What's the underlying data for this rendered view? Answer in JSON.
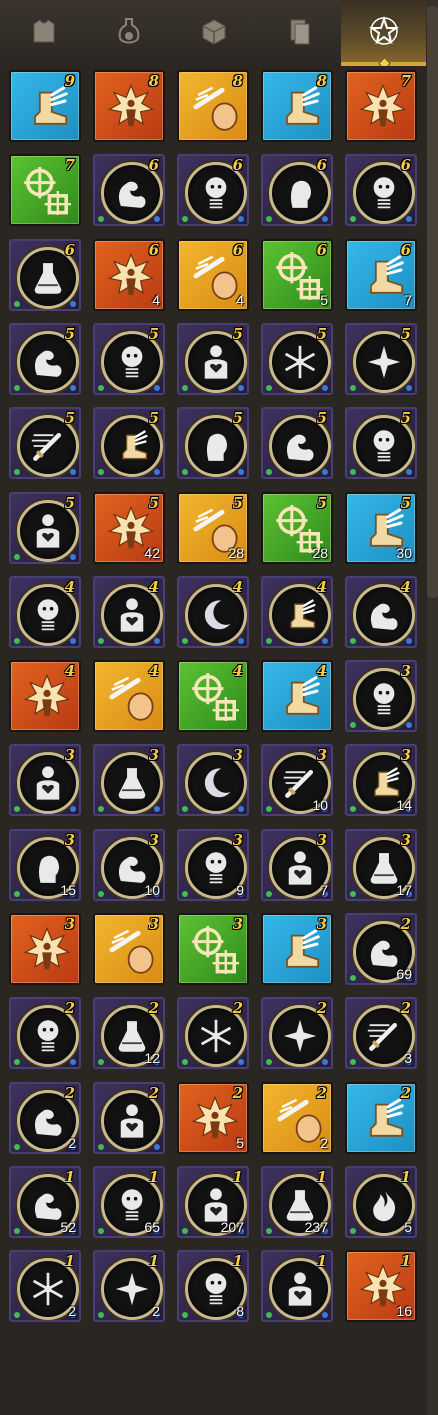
{
  "tabs": [
    {
      "name": "armor-tab",
      "icon": "armor-icon"
    },
    {
      "name": "potion-tab",
      "icon": "potion-icon"
    },
    {
      "name": "materials-tab",
      "icon": "cubes-icon"
    },
    {
      "name": "cards-tab",
      "icon": "cards-icon"
    },
    {
      "name": "runes-tab",
      "icon": "star-emblem-icon",
      "active": true
    }
  ],
  "tile_styles": {
    "blue": [
      "#1d8fc3",
      "#35b8e8"
    ],
    "red": [
      "#b93a14",
      "#e2631e"
    ],
    "orange": [
      "#d98c14",
      "#f2b62e"
    ],
    "green": [
      "#2f8a1c",
      "#5cc332"
    ],
    "dark": "round-purple-frame"
  },
  "items": [
    {
      "icon": "winged-boot-icon",
      "bg": "blue",
      "level": "9",
      "qty": ""
    },
    {
      "icon": "starburst-figure-icon",
      "bg": "red",
      "level": "8",
      "qty": ""
    },
    {
      "icon": "sword-head-icon",
      "bg": "orange",
      "level": "8",
      "qty": ""
    },
    {
      "icon": "winged-boot-icon",
      "bg": "blue",
      "level": "8",
      "qty": ""
    },
    {
      "icon": "starburst-figure-icon",
      "bg": "red",
      "level": "7",
      "qty": ""
    },
    {
      "icon": "crosshair-icon",
      "bg": "green",
      "level": "7",
      "qty": ""
    },
    {
      "icon": "flexed-arm-icon",
      "bg": "dark",
      "level": "6",
      "qty": ""
    },
    {
      "icon": "spring-head-icon",
      "bg": "dark",
      "level": "6",
      "qty": ""
    },
    {
      "icon": "head-bust-icon",
      "bg": "dark",
      "level": "6",
      "qty": ""
    },
    {
      "icon": "spring-head-icon",
      "bg": "dark",
      "level": "6",
      "qty": ""
    },
    {
      "icon": "flask-icon",
      "bg": "dark",
      "level": "6",
      "qty": ""
    },
    {
      "icon": "starburst-figure-icon",
      "bg": "red",
      "level": "6",
      "qty": "4"
    },
    {
      "icon": "sword-head-icon",
      "bg": "orange",
      "level": "6",
      "qty": "4"
    },
    {
      "icon": "crosshair-icon",
      "bg": "green",
      "level": "6",
      "qty": "5"
    },
    {
      "icon": "winged-boot-icon",
      "bg": "blue",
      "level": "6",
      "qty": "7"
    },
    {
      "icon": "flexed-arm-icon",
      "bg": "dark",
      "level": "5",
      "qty": ""
    },
    {
      "icon": "spring-head-icon",
      "bg": "dark",
      "level": "5",
      "qty": ""
    },
    {
      "icon": "heart-body-icon",
      "bg": "dark",
      "level": "5",
      "qty": ""
    },
    {
      "icon": "snowflake-icon",
      "bg": "dark",
      "level": "5",
      "qty": ""
    },
    {
      "icon": "four-point-star-icon",
      "bg": "dark",
      "level": "5",
      "qty": ""
    },
    {
      "icon": "sword-icon",
      "bg": "dark",
      "level": "5",
      "qty": ""
    },
    {
      "icon": "winged-boot-icon",
      "bg": "dark",
      "level": "5",
      "qty": ""
    },
    {
      "icon": "head-bust-icon",
      "bg": "dark",
      "level": "5",
      "qty": ""
    },
    {
      "icon": "flexed-arm-icon",
      "bg": "dark",
      "level": "5",
      "qty": ""
    },
    {
      "icon": "spring-head-icon",
      "bg": "dark",
      "level": "5",
      "qty": ""
    },
    {
      "icon": "heart-body-icon",
      "bg": "dark",
      "level": "5",
      "qty": ""
    },
    {
      "icon": "starburst-figure-icon",
      "bg": "red",
      "level": "5",
      "qty": "42"
    },
    {
      "icon": "sword-head-icon",
      "bg": "orange",
      "level": "5",
      "qty": "28"
    },
    {
      "icon": "crosshair-icon",
      "bg": "green",
      "level": "5",
      "qty": "28"
    },
    {
      "icon": "winged-boot-icon",
      "bg": "blue",
      "level": "5",
      "qty": "30"
    },
    {
      "icon": "spring-head-icon",
      "bg": "dark",
      "level": "4",
      "qty": ""
    },
    {
      "icon": "heart-body-icon",
      "bg": "dark",
      "level": "4",
      "qty": ""
    },
    {
      "icon": "crescent-moon-icon",
      "bg": "dark",
      "level": "4",
      "qty": ""
    },
    {
      "icon": "winged-boot-icon",
      "bg": "dark",
      "level": "4",
      "qty": ""
    },
    {
      "icon": "flexed-arm-icon",
      "bg": "dark",
      "level": "4",
      "qty": ""
    },
    {
      "icon": "starburst-figure-icon",
      "bg": "red",
      "level": "4",
      "qty": ""
    },
    {
      "icon": "sword-head-icon",
      "bg": "orange",
      "level": "4",
      "qty": ""
    },
    {
      "icon": "crosshair-icon",
      "bg": "green",
      "level": "4",
      "qty": ""
    },
    {
      "icon": "winged-boot-icon",
      "bg": "blue",
      "level": "4",
      "qty": ""
    },
    {
      "icon": "spring-head-icon",
      "bg": "dark",
      "level": "3",
      "qty": ""
    },
    {
      "icon": "heart-body-icon",
      "bg": "dark",
      "level": "3",
      "qty": ""
    },
    {
      "icon": "flask-icon",
      "bg": "dark",
      "level": "3",
      "qty": ""
    },
    {
      "icon": "crescent-moon-icon",
      "bg": "dark",
      "level": "3",
      "qty": ""
    },
    {
      "icon": "sword-icon",
      "bg": "dark",
      "level": "3",
      "qty": "10"
    },
    {
      "icon": "winged-boot-icon",
      "bg": "dark",
      "level": "3",
      "qty": "14"
    },
    {
      "icon": "head-bust-icon",
      "bg": "dark",
      "level": "3",
      "qty": "15"
    },
    {
      "icon": "flexed-arm-icon",
      "bg": "dark",
      "level": "3",
      "qty": "10"
    },
    {
      "icon": "spring-head-icon",
      "bg": "dark",
      "level": "3",
      "qty": "9"
    },
    {
      "icon": "heart-body-icon",
      "bg": "dark",
      "level": "3",
      "qty": "7"
    },
    {
      "icon": "flask-icon",
      "bg": "dark",
      "level": "3",
      "qty": "17"
    },
    {
      "icon": "starburst-figure-icon",
      "bg": "red",
      "level": "3",
      "qty": ""
    },
    {
      "icon": "sword-head-icon",
      "bg": "orange",
      "level": "3",
      "qty": ""
    },
    {
      "icon": "crosshair-icon",
      "bg": "green",
      "level": "3",
      "qty": ""
    },
    {
      "icon": "winged-boot-icon",
      "bg": "blue",
      "level": "3",
      "qty": ""
    },
    {
      "icon": "flexed-arm-icon",
      "bg": "dark",
      "level": "2",
      "qty": "69"
    },
    {
      "icon": "spring-head-icon",
      "bg": "dark",
      "level": "2",
      "qty": ""
    },
    {
      "icon": "flask-icon",
      "bg": "dark",
      "level": "2",
      "qty": "12"
    },
    {
      "icon": "snowflake-icon",
      "bg": "dark",
      "level": "2",
      "qty": ""
    },
    {
      "icon": "four-point-star-icon",
      "bg": "dark",
      "level": "2",
      "qty": ""
    },
    {
      "icon": "sword-icon",
      "bg": "dark",
      "level": "2",
      "qty": "3"
    },
    {
      "icon": "flexed-arm-icon",
      "bg": "dark",
      "level": "2",
      "qty": "2"
    },
    {
      "icon": "heart-body-icon",
      "bg": "dark",
      "level": "2",
      "qty": ""
    },
    {
      "icon": "starburst-figure-icon",
      "bg": "red",
      "level": "2",
      "qty": "5"
    },
    {
      "icon": "sword-head-icon",
      "bg": "orange",
      "level": "2",
      "qty": "2"
    },
    {
      "icon": "winged-boot-icon",
      "bg": "blue",
      "level": "2",
      "qty": ""
    },
    {
      "icon": "flexed-arm-icon",
      "bg": "dark",
      "level": "1",
      "qty": "52"
    },
    {
      "icon": "spring-head-icon",
      "bg": "dark",
      "level": "1",
      "qty": "65"
    },
    {
      "icon": "heart-body-icon",
      "bg": "dark",
      "level": "1",
      "qty": "207"
    },
    {
      "icon": "flask-icon",
      "bg": "dark",
      "level": "1",
      "qty": "237"
    },
    {
      "icon": "flame-icon",
      "bg": "dark",
      "level": "1",
      "qty": "5"
    },
    {
      "icon": "snowflake-icon",
      "bg": "dark",
      "level": "1",
      "qty": "2"
    },
    {
      "icon": "four-point-star-icon",
      "bg": "dark",
      "level": "1",
      "qty": "2"
    },
    {
      "icon": "spring-head-icon",
      "bg": "dark",
      "level": "1",
      "qty": "8"
    },
    {
      "icon": "heart-body-icon",
      "bg": "dark",
      "level": "1",
      "qty": ""
    },
    {
      "icon": "starburst-figure-icon",
      "bg": "red",
      "level": "1",
      "qty": "16"
    }
  ]
}
